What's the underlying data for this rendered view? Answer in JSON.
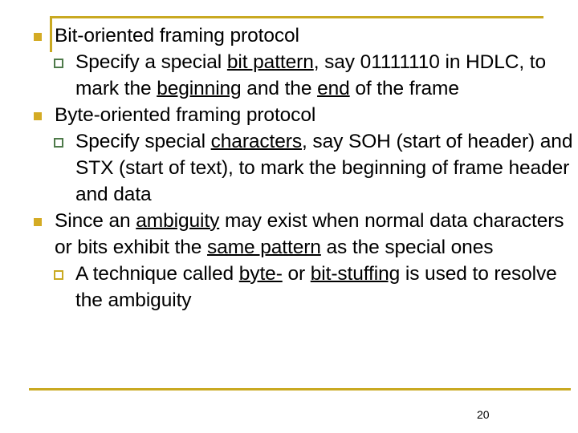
{
  "slide": {
    "page_number": "20",
    "accent_color": "#c9a921",
    "bullet1_color": "#d4ab24",
    "bullet2_color": "#4e7a4a",
    "bullet2_alt_color": "#c9a921",
    "text_color": "#000000",
    "background_color": "#ffffff"
  },
  "bullets": [
    {
      "level1": "Bit-oriented framing protocol",
      "sub": [
        {
          "marker": "green-square-outline",
          "parts": [
            {
              "text": "Specify a special "
            },
            {
              "text": "bit pattern",
              "underline": true
            },
            {
              "text": ", say 01111110 in HDLC, to mark the "
            },
            {
              "text": "beginning",
              "underline": true
            },
            {
              "text": " and the "
            },
            {
              "text": "end",
              "underline": true
            },
            {
              "text": " of the frame"
            }
          ]
        }
      ]
    },
    {
      "level1": "Byte-oriented framing protocol",
      "sub": [
        {
          "marker": "green-square-outline",
          "parts": [
            {
              "text": "Specify special "
            },
            {
              "text": "characters",
              "underline": true
            },
            {
              "text": ", say SOH (start of header) and STX (start of text), to mark the beginning of frame header and data"
            }
          ]
        }
      ]
    },
    {
      "level1_parts": [
        {
          "text": "Since an "
        },
        {
          "text": "ambiguity",
          "underline": true
        },
        {
          "text": " may exist when normal data characters or bits exhibit the "
        },
        {
          "text": "same pattern",
          "underline": true
        },
        {
          "text": " as the special ones"
        }
      ],
      "sub": [
        {
          "marker": "gold-square-outline",
          "parts": [
            {
              "text": "A technique called "
            },
            {
              "text": "byte-",
              "underline": true
            },
            {
              "text": " or "
            },
            {
              "text": "bit-stuffing",
              "underline": true
            },
            {
              "text": " is used to resolve the ambiguity"
            }
          ]
        }
      ]
    }
  ]
}
